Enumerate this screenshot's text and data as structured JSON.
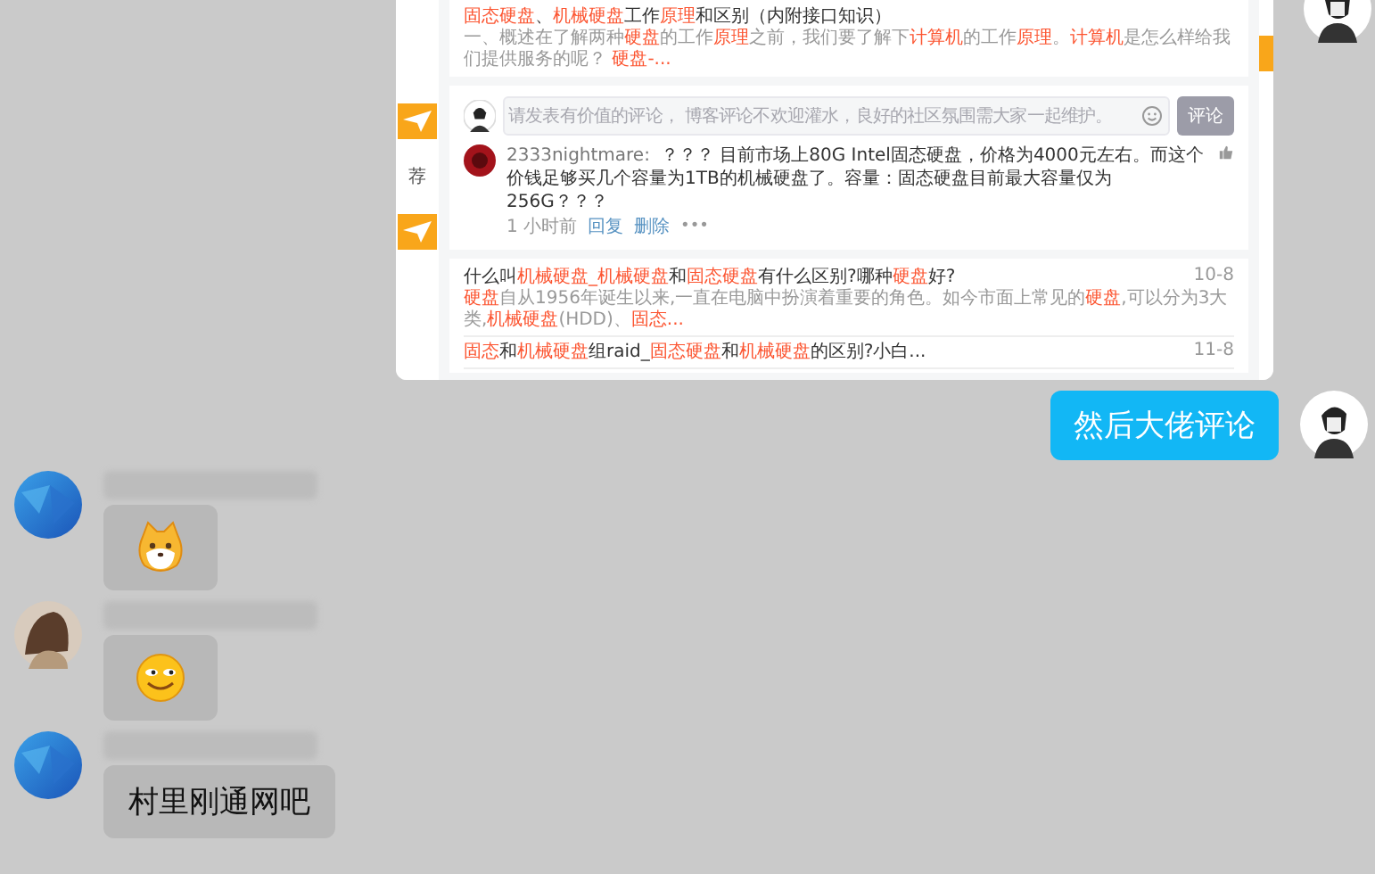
{
  "shared_screenshot": {
    "sidebar_label": "荐",
    "first_result": {
      "title": "**固态硬盘**、**机械硬盘**工作**原理**和区别（内附接口知识）",
      "snippet": "一、概述在了解两种**硬盘**的工作**原理**之前，我们要了解下**计算机**的工作**原理**。**计算机**是怎么样给我们提供服务的呢？ **硬盘-...**"
    },
    "comment_box": {
      "placeholder": "请发表有价值的评论， 博客评论不欢迎灌水，良好的社区氛围需大家一起维护。",
      "button": "评论"
    },
    "comments": [
      {
        "user": "2333nightmare:",
        "text": "？？？ 目前市场上80G Intel固态硬盘，价格为4000元左右。而这个价钱足够买几个容量为1TB的机械硬盘了。容量：固态硬盘目前最大容量仅为256G？？？",
        "time": "1 小时前",
        "actions": [
          "回复",
          "删除"
        ],
        "more": "•••"
      }
    ],
    "results": [
      {
        "title": "什么叫**机械硬盘_机械硬盘**和**固态硬盘**有什么区别?哪种**硬盘**好?",
        "date": "10-8",
        "snippet": "**硬盘**自从1956年诞生以来,一直在电脑中扮演着重要的角色。如今市面上常见的**硬盘**,可以分为3大类,**机械硬盘**(HDD)、**固态...**"
      },
      {
        "title": "**固态**和**机械硬盘**组raid_**固态硬盘**和**机械硬盘**的区别?小白...",
        "date": "11-8"
      }
    ]
  },
  "messages": [
    {
      "kind": "outgoing-text",
      "text": "然后大佬评论"
    },
    {
      "kind": "incoming-dog-sticker"
    },
    {
      "kind": "incoming-grin-sticker"
    },
    {
      "kind": "incoming-text",
      "text": "村里刚通网吧"
    }
  ]
}
